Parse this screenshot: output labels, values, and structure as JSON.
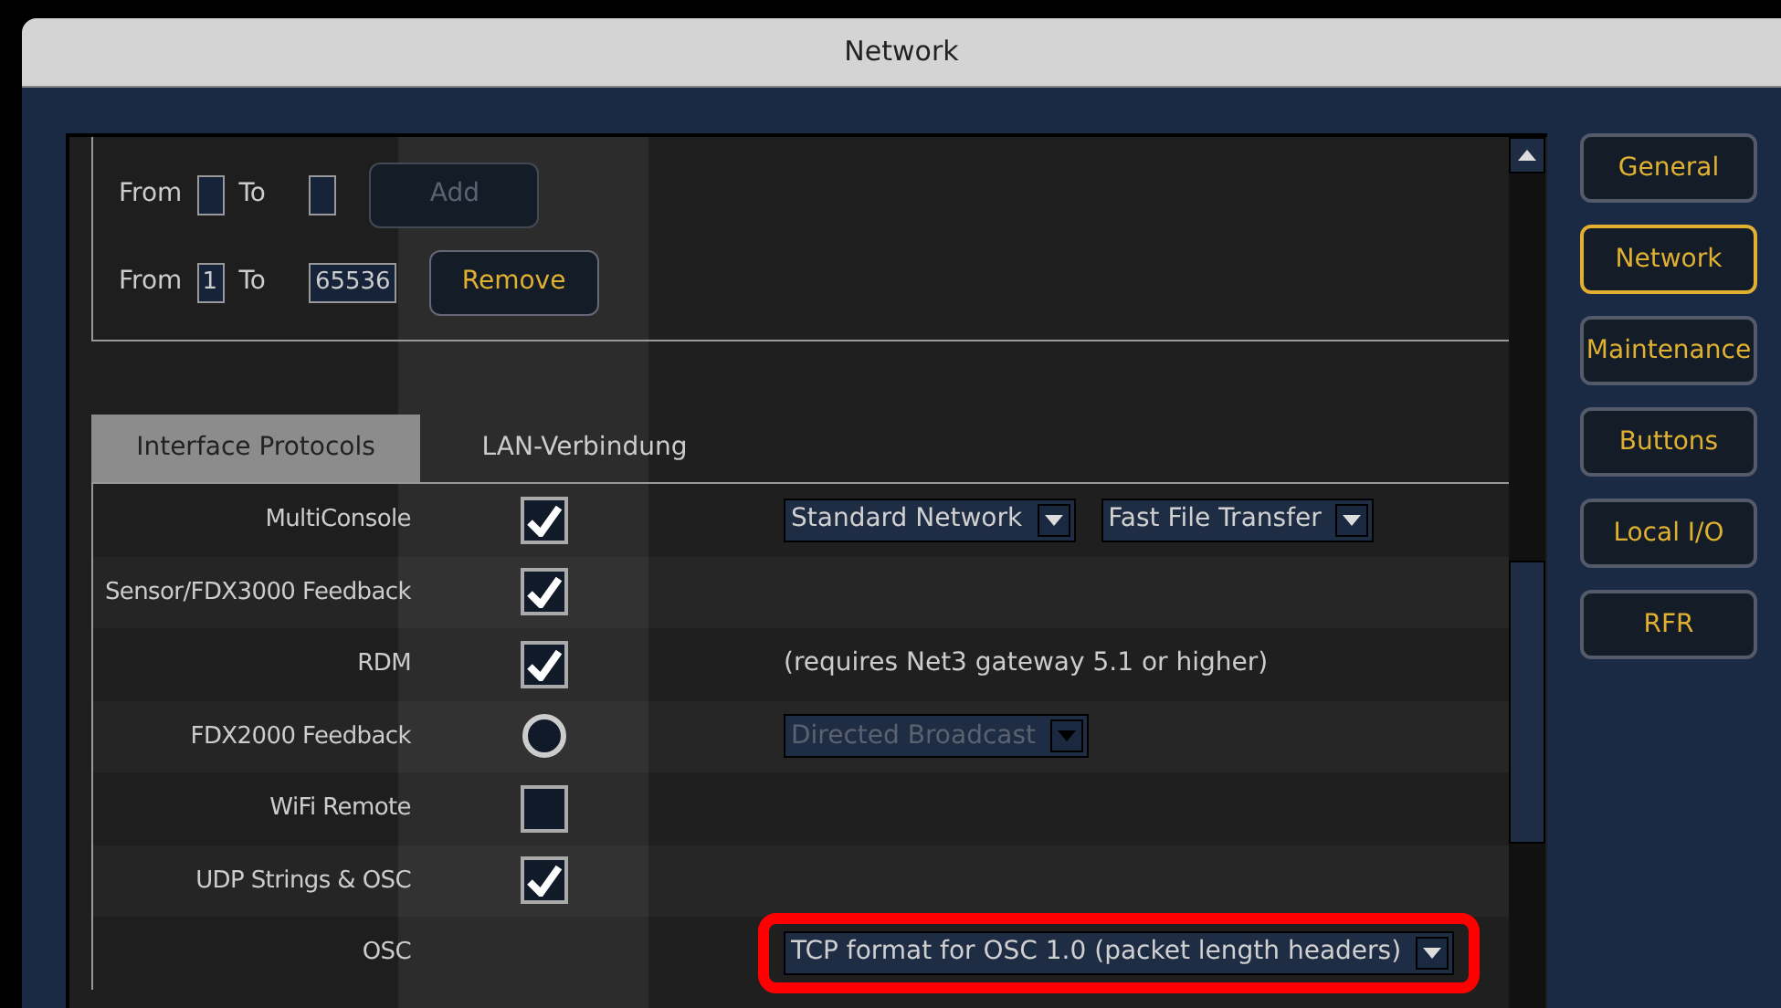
{
  "window": {
    "title": "Network"
  },
  "ranges": [
    {
      "from_label": "From",
      "to_label": "To",
      "button": "Add",
      "disabled": true
    },
    {
      "from_label": "From",
      "from": "1",
      "to_label": "To",
      "to": "65536",
      "button": "Remove",
      "disabled": false
    }
  ],
  "tabs": [
    {
      "label": "Interface Protocols",
      "selected": true
    },
    {
      "label": "LAN-Verbindung",
      "selected": false
    }
  ],
  "rows": [
    {
      "label": "MultiConsole",
      "kind": "checkbox",
      "checked": true,
      "extras": [
        {
          "kind": "dropdown",
          "value": "Standard Network",
          "disabled": false,
          "highlighted": false
        },
        {
          "kind": "dropdown",
          "value": "Fast File Transfer",
          "disabled": false,
          "highlighted": false
        }
      ]
    },
    {
      "label": "Sensor/FDX3000 Feedback",
      "kind": "checkbox",
      "checked": true,
      "extras": []
    },
    {
      "label": "RDM",
      "kind": "checkbox",
      "checked": true,
      "extras": [
        {
          "kind": "note",
          "text": "(requires Net3 gateway 5.1 or higher)"
        }
      ]
    },
    {
      "label": "FDX2000 Feedback",
      "kind": "radio",
      "checked": false,
      "extras": [
        {
          "kind": "dropdown",
          "value": "Directed Broadcast",
          "disabled": true,
          "highlighted": false
        }
      ]
    },
    {
      "label": "WiFi Remote",
      "kind": "checkbox",
      "checked": false,
      "extras": []
    },
    {
      "label": "UDP Strings & OSC",
      "kind": "checkbox",
      "checked": true,
      "extras": []
    },
    {
      "label": "OSC",
      "kind": "none",
      "extras": [
        {
          "kind": "dropdown",
          "value": "TCP format for OSC 1.0 (packet length headers)",
          "disabled": false,
          "highlighted": true
        }
      ]
    }
  ],
  "nav": [
    {
      "label": "General",
      "selected": false
    },
    {
      "label": "Network",
      "selected": true
    },
    {
      "label": "Maintenance",
      "selected": false
    },
    {
      "label": "Buttons",
      "selected": false
    },
    {
      "label": "Local I/O",
      "selected": false
    },
    {
      "label": "RFR",
      "selected": false
    }
  ]
}
